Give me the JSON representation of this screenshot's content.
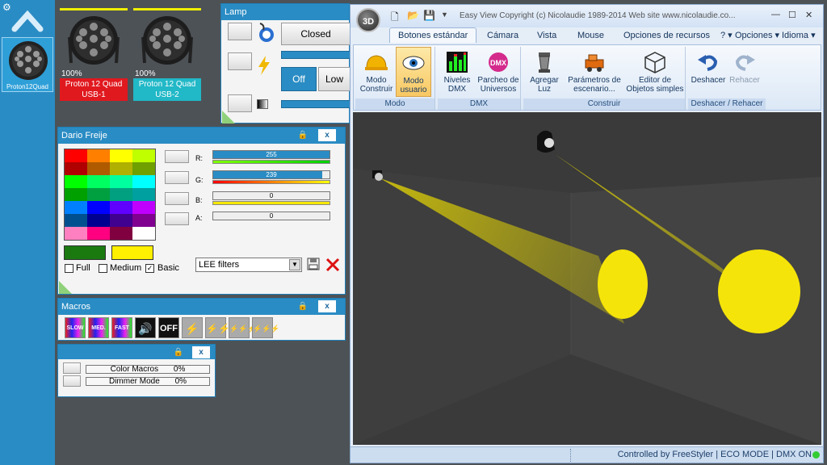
{
  "fixture_sidebar": {
    "fixture_label": "Proton12Quad"
  },
  "fixtures": [
    {
      "percent": "100%",
      "name_line1": "Proton 12 Quad",
      "name_line2": "USB-1",
      "color": "#e0191f"
    },
    {
      "percent": "100%",
      "name_line1": "Proton 12 Quad",
      "name_line2": "USB-2",
      "color": "#21b8c7"
    }
  ],
  "lamp_panel": {
    "title": "Lamp",
    "closed_label": "Closed",
    "off_label": "Off",
    "low_label": "Low"
  },
  "color_panel": {
    "title": "Dario Freije",
    "close_label": "x",
    "channels": [
      {
        "label": "R:",
        "value": "255",
        "level": 1.0
      },
      {
        "label": "G:",
        "value": "239",
        "level": 0.94
      },
      {
        "label": "B:",
        "value": "0",
        "level": 0
      },
      {
        "label": "A:",
        "value": "0",
        "level": 0
      }
    ],
    "options": [
      {
        "label": "Full",
        "checked": false
      },
      {
        "label": "Medium",
        "checked": false
      },
      {
        "label": "Basic",
        "checked": true
      }
    ],
    "filter_select": "LEE filters",
    "palette": [
      "#ff0000",
      "#ff7f00",
      "#ffff00",
      "#bfff00",
      "#b00000",
      "#b05a00",
      "#b0b000",
      "#6fa000",
      "#00ff00",
      "#00ff60",
      "#00ff9f",
      "#00ffff",
      "#00a000",
      "#00a040",
      "#00a080",
      "#00a0a0",
      "#0080ff",
      "#0000ff",
      "#6000ff",
      "#bf00ff",
      "#005090",
      "#000090",
      "#400090",
      "#800090",
      "#ff80c0",
      "#ff0080",
      "#800040",
      "#ffffff"
    ],
    "swatch_a": "#1a7a10",
    "swatch_b": "#ffef00"
  },
  "macros_panel": {
    "title": "Macros",
    "close_label": "x",
    "icons": [
      "SLOW",
      "MED.",
      "FAST",
      "sound-icon",
      "OFF",
      "strobe-1-icon",
      "strobe-2-icon",
      "strobe-3-icon",
      "strobe-4-icon"
    ],
    "icon_text": {
      "slow": "SLOW",
      "med": "MED.",
      "fast": "FAST",
      "off": "OFF"
    }
  },
  "modes_panel": {
    "close_label": "x",
    "rows": [
      {
        "label": "Color Macros",
        "value": "0%"
      },
      {
        "label": "Dimmer Mode",
        "value": "0%"
      }
    ]
  },
  "app": {
    "orb_label": "3D",
    "title": "Easy View   Copyright (c) Nicolaudie 1989-2014   Web site www.nicolaudie.co...",
    "tabs": [
      "Botones estándar",
      "Cámara",
      "Vista",
      "Mouse",
      "Opciones de recursos"
    ],
    "right_tabs": [
      "?",
      "Opciones",
      "Idioma"
    ],
    "groups": [
      {
        "label": "Modo",
        "buttons": [
          "Modo Construir",
          "Modo usuario"
        ]
      },
      {
        "label": "DMX",
        "buttons": [
          "Niveles DMX",
          "Parcheo de Universos"
        ]
      },
      {
        "label": "Construir",
        "buttons": [
          "Agregar Luz",
          "Parámetros de escenario...",
          "Editor de Objetos simples"
        ]
      },
      {
        "label": "Deshacer / Rehacer",
        "buttons": [
          "Deshacer",
          "Rehacer"
        ]
      }
    ],
    "status": "Controlled by FreeStyler  |  ECO MODE  |  DMX ON"
  }
}
